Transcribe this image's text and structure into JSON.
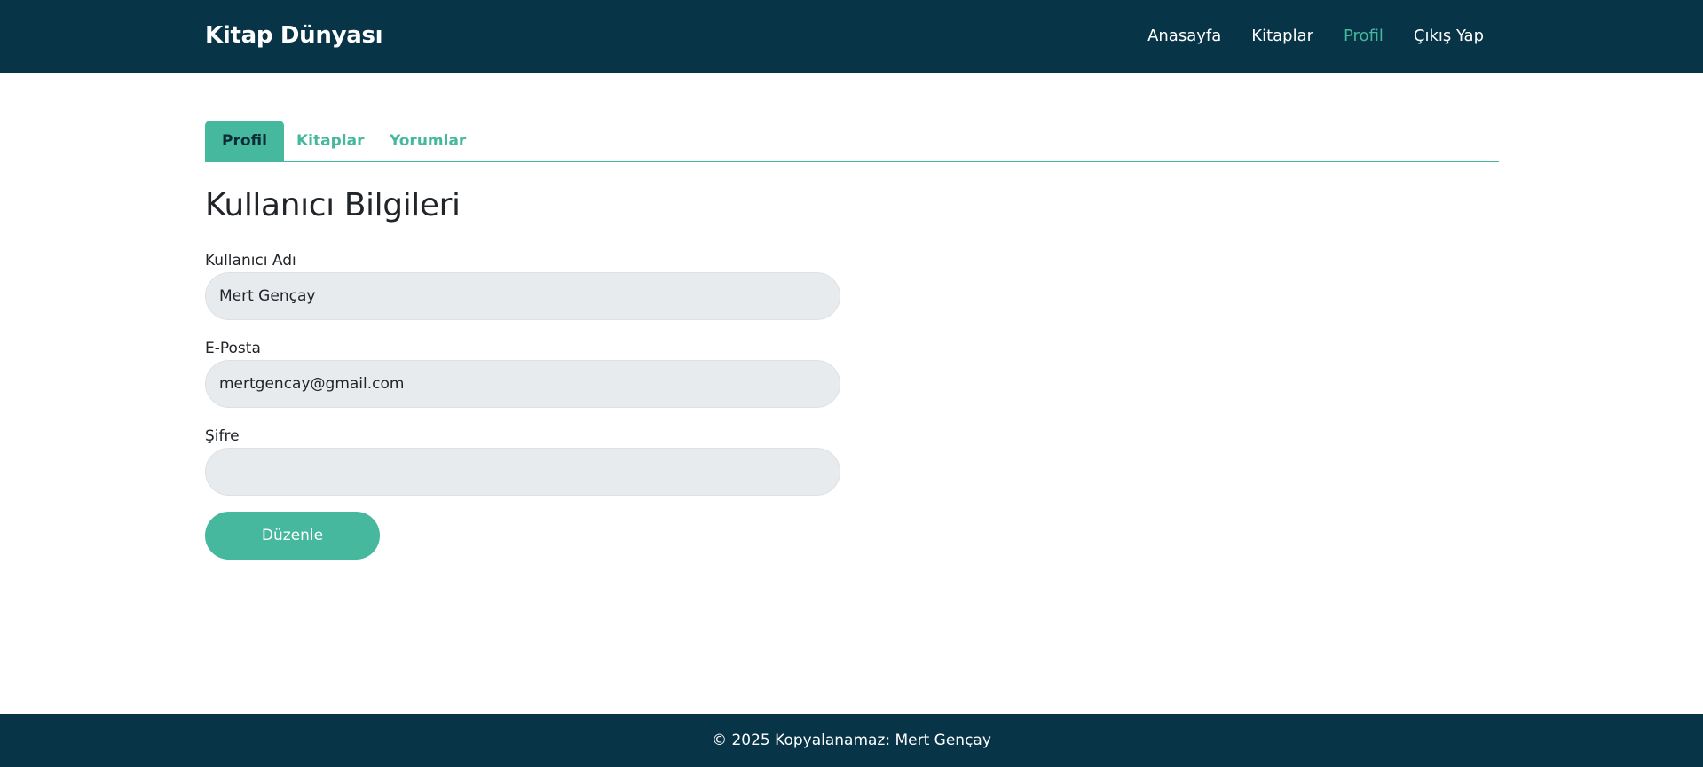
{
  "navbar": {
    "brand": "Kitap Dünyası",
    "links": [
      {
        "label": "Anasayfa",
        "active": false
      },
      {
        "label": "Kitaplar",
        "active": false
      },
      {
        "label": "Profil",
        "active": true
      },
      {
        "label": "Çıkış Yap",
        "active": false
      }
    ]
  },
  "tabs": [
    {
      "label": "Profil",
      "active": true
    },
    {
      "label": "Kitaplar",
      "active": false
    },
    {
      "label": "Yorumlar",
      "active": false
    }
  ],
  "profile_form": {
    "title": "Kullanıcı Bilgileri",
    "username": {
      "label": "Kullanıcı Adı",
      "value": "Mert Gençay"
    },
    "email": {
      "label": "E-Posta",
      "value": "mertgencay@gmail.com"
    },
    "password": {
      "label": "Şifre",
      "value": ""
    },
    "submit_label": "Düzenle"
  },
  "footer": {
    "text": "© 2025 Kopyalanamaz: Mert Gençay"
  },
  "colors": {
    "navbar_bg": "#073447",
    "accent": "#45b89d",
    "input_bg": "#e8ebee"
  }
}
